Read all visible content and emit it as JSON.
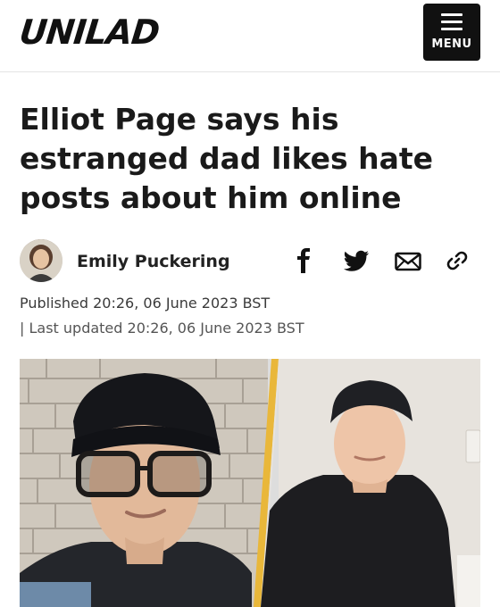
{
  "header": {
    "logo": "UNILAD",
    "menu_label": "MENU"
  },
  "article": {
    "headline": "Elliot Page says his estranged dad likes hate posts about him online",
    "author": "Emily Puckering",
    "published": "Published 20:26, 06 June 2023 BST",
    "updated": "| Last updated 20:26, 06 June 2023 BST"
  },
  "share_icons": [
    "facebook-icon",
    "twitter-icon",
    "email-icon",
    "link-icon"
  ],
  "colors": {
    "accent_divider": "#e9b73a",
    "menu_background": "#111111"
  }
}
